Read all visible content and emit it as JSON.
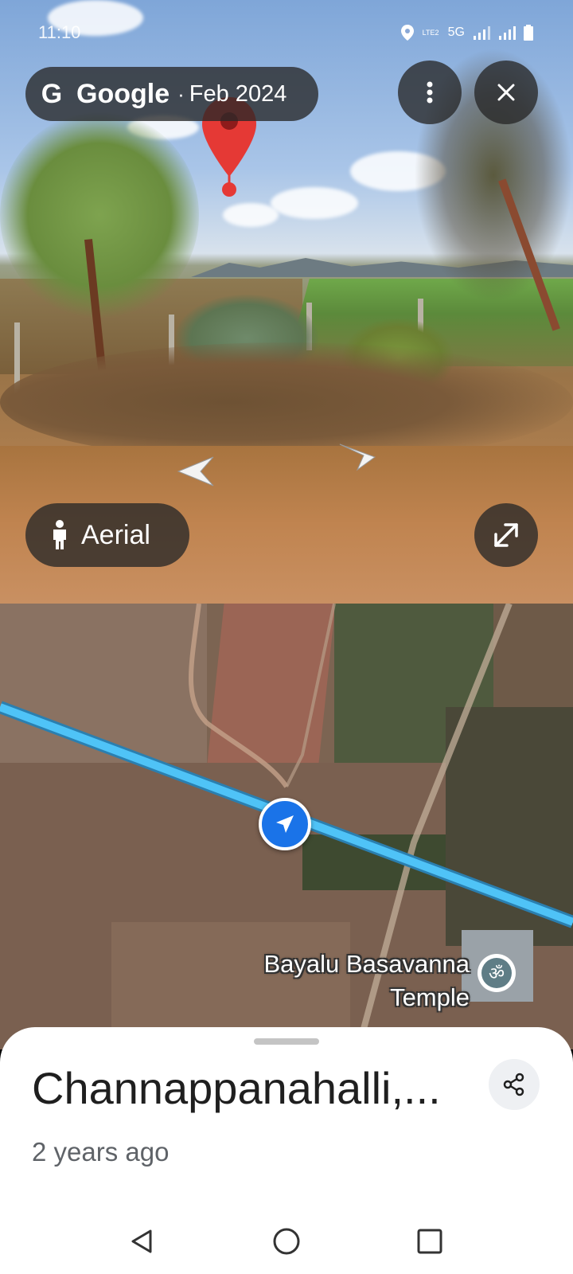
{
  "status_bar": {
    "time": "11:10",
    "network": "5G",
    "lte_label": "LTE2",
    "icons": [
      "location-icon",
      "signal-icon",
      "signal-icon",
      "battery-icon"
    ]
  },
  "street_view": {
    "brand_g": "G",
    "brand": "Google",
    "separator": "·",
    "capture_date": "Feb 2024",
    "aerial_label": "Aerial",
    "icons": [
      "more-vert-icon",
      "close-icon",
      "expand-icon",
      "person-icon",
      "pin-icon",
      "nav-arrow-icon"
    ]
  },
  "map": {
    "place_label_line1": "Bayalu Basavanna",
    "place_label_line2": "Temple",
    "temple_glyph": "ॐ",
    "route_color": "#4fc3f7",
    "marker_color": "#1a73e8"
  },
  "sheet": {
    "title": "Channappanahalli,...",
    "subtitle": "2 years ago",
    "share_icon": "share-icon"
  },
  "nav": {
    "buttons": [
      "back-icon",
      "home-icon",
      "recents-icon"
    ]
  }
}
